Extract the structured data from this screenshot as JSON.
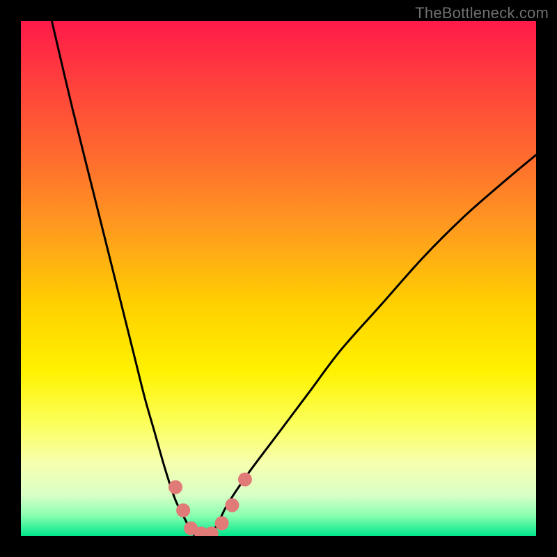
{
  "watermark": {
    "text": "TheBottleneck.com"
  },
  "chart_data": {
    "type": "line",
    "title": "",
    "xlabel": "",
    "ylabel": "",
    "xlim": [
      0,
      100
    ],
    "ylim": [
      0,
      100
    ],
    "grid": false,
    "legend": false,
    "series": [
      {
        "name": "bottleneck-curve",
        "x": [
          6,
          10,
          14,
          18,
          22,
          24,
          26,
          28,
          30,
          32,
          33,
          34,
          36,
          38,
          40,
          44,
          50,
          56,
          62,
          70,
          78,
          86,
          94,
          100
        ],
        "y": [
          100,
          83,
          67,
          51,
          35,
          27,
          20,
          13,
          7,
          3,
          1,
          0,
          0,
          2,
          6,
          12,
          20,
          28,
          36,
          45,
          54,
          62,
          69,
          74
        ]
      }
    ],
    "markers": [
      {
        "name": "marker-left-upper",
        "x": 30.0,
        "y": 9.5
      },
      {
        "name": "marker-left-mid",
        "x": 31.5,
        "y": 5.0
      },
      {
        "name": "marker-bottom-1",
        "x": 33.0,
        "y": 1.5
      },
      {
        "name": "marker-bottom-2",
        "x": 35.0,
        "y": 0.5
      },
      {
        "name": "marker-bottom-3",
        "x": 37.0,
        "y": 0.5
      },
      {
        "name": "marker-bottom-4",
        "x": 39.0,
        "y": 2.5
      },
      {
        "name": "marker-right-mid",
        "x": 41.0,
        "y": 6.0
      },
      {
        "name": "marker-right-upper",
        "x": 43.5,
        "y": 11.0
      }
    ],
    "marker_color": "#e07b78",
    "curve_color": "#000000"
  }
}
